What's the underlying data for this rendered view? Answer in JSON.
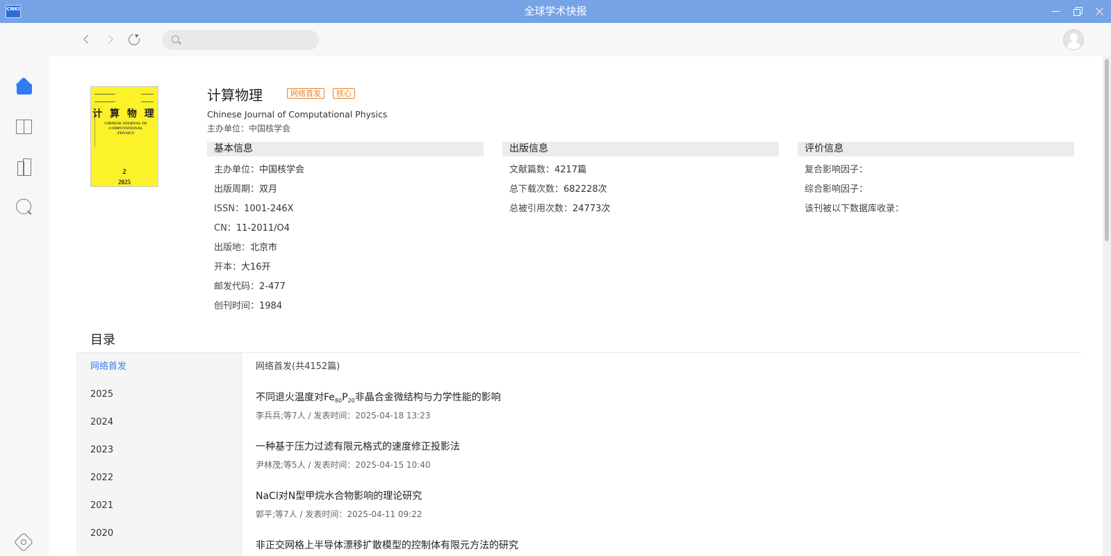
{
  "window": {
    "logo_text": "CNKI",
    "title": "全球学术快报"
  },
  "toolbar": {
    "search_placeholder": ""
  },
  "sidebar": {
    "items": [
      "home-icon",
      "book-icon",
      "library-icon",
      "search-icon",
      "settings-icon"
    ]
  },
  "journal": {
    "title": "计算物理",
    "badges": [
      "网络首发",
      "核心"
    ],
    "english_name": "Chinese Journal of Computational Physics",
    "sponsor_label": "主办单位：",
    "sponsor_value": "中国核学会",
    "cover": {
      "title": "计 算 物 理",
      "english": "CHINESE JOURNAL OF COMPUTATIONAL PHYSICS",
      "number": "2",
      "year": "2025",
      "color": "#fbf22a"
    }
  },
  "basic_info": {
    "heading": "基本信息",
    "items": [
      {
        "label": "主办单位：",
        "value": "中国核学会"
      },
      {
        "label": "出版周期：",
        "value": "双月"
      },
      {
        "label": "ISSN：",
        "value": "1001-246X"
      },
      {
        "label": "CN：",
        "value": "11-2011/O4"
      },
      {
        "label": "出版地：",
        "value": "北京市"
      },
      {
        "label": "开本：",
        "value": "大16开"
      },
      {
        "label": "邮发代码：",
        "value": "2-477"
      },
      {
        "label": "创刊时间：",
        "value": "1984"
      }
    ]
  },
  "publish_info": {
    "heading": "出版信息",
    "items": [
      {
        "label": "文献篇数：",
        "value": "4217篇"
      },
      {
        "label": "总下载次数：",
        "value": "682228次"
      },
      {
        "label": "总被引用次数：",
        "value": "24773次"
      }
    ]
  },
  "eval_info": {
    "heading": "评价信息",
    "items": [
      {
        "label": "复合影响因子：",
        "value": ""
      },
      {
        "label": "综合影响因子：",
        "value": ""
      },
      {
        "label": "该刊被以下数据库收录：",
        "value": ""
      }
    ]
  },
  "toc": {
    "title": "目录",
    "nav": [
      "网络首发",
      "2025",
      "2024",
      "2023",
      "2022",
      "2021",
      "2020"
    ],
    "active_index": 0,
    "count_label": "网络首发(共4152篇)",
    "articles": [
      {
        "title_pre": "不同退火温度对Fe",
        "sub1": "80",
        "title_mid": "P",
        "sub2": "20",
        "title_post": "非晶合金微结构与力学性能的影响",
        "meta": "李兵兵;等7人 / 发表时间：2025-04-18 13:23"
      },
      {
        "title": "一种基于压力过滤有限元格式的速度修正投影法",
        "meta": "尹林茂;等5人 / 发表时间：2025-04-15 10:40"
      },
      {
        "title": "NaCl对N型甲烷水合物影响的理论研究",
        "meta": "郭平;等7人 / 发表时间：2025-04-11 09:22"
      },
      {
        "title": "非正交网格上半导体漂移扩散模型的控制体有限元方法的研究",
        "meta": ""
      }
    ]
  },
  "colors": {
    "titlebar": "#75a3e6",
    "accent": "#3a7ff0",
    "badge": "#e8822d"
  }
}
